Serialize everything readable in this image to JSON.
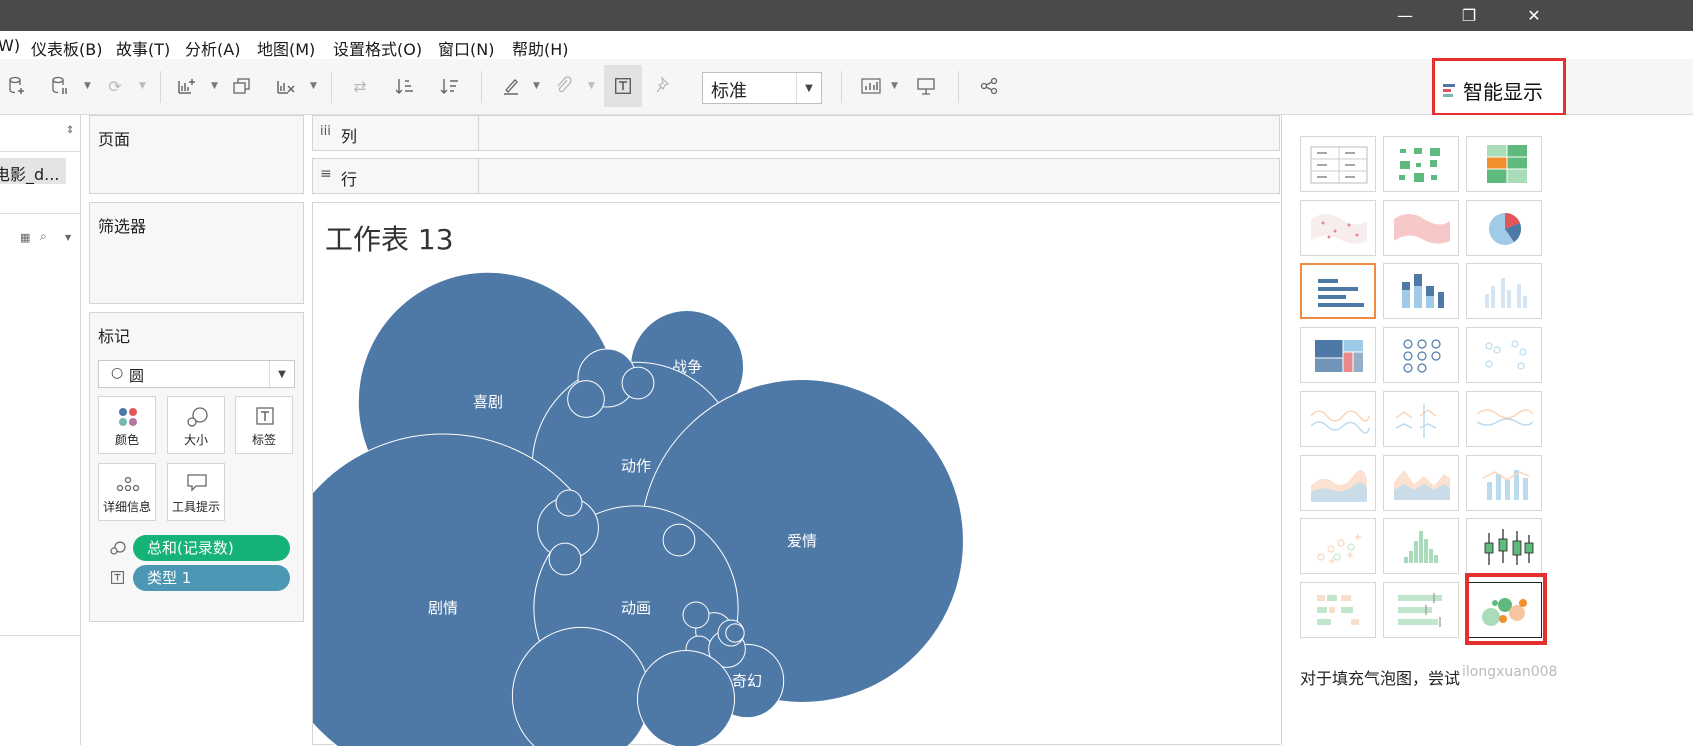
{
  "window": {
    "minimize_glyph": "—",
    "restore_glyph": "❐",
    "close_glyph": "✕"
  },
  "menu": [
    "W)",
    "仪表板(B)",
    "故事(T)",
    "分析(A)",
    "地图(M)",
    "设置格式(O)",
    "窗口(N)",
    "帮助(H)"
  ],
  "toolbar": {
    "mark_size_value": "标准",
    "show_me_label": "智能显示"
  },
  "datasource": {
    "name": "电影_d..."
  },
  "shelves": {
    "pages": "页面",
    "filters": "筛选器",
    "columns": "列",
    "rows": "行"
  },
  "marks": {
    "title": "标记",
    "type": "圆",
    "buttons": [
      {
        "label": "颜色",
        "icon": "color-icon"
      },
      {
        "label": "大小",
        "icon": "size-icon"
      },
      {
        "label": "标签",
        "icon": "label-icon"
      },
      {
        "label": "详细信息",
        "icon": "detail-icon"
      },
      {
        "label": "工具提示",
        "icon": "tooltip-icon"
      }
    ],
    "pills": [
      {
        "text": "总和(记录数)",
        "color": "#16b378",
        "icon": "size-icon"
      },
      {
        "text": "类型   1",
        "color": "#4b97b4",
        "icon": "label-icon"
      }
    ]
  },
  "sheet": {
    "title": "工作表 13"
  },
  "bubble_color": "#4e79a7",
  "bubbles": [
    {
      "label": "喜剧",
      "value": 100
    },
    {
      "label": "战争",
      "value": 19
    },
    {
      "label": "动作",
      "value": 64
    },
    {
      "label": "爱情",
      "value": 155
    },
    {
      "label": "剧情",
      "value": 180
    },
    {
      "label": "动画",
      "value": 62
    },
    {
      "label": "奇幻",
      "value": 8
    },
    {
      "label": "",
      "value": 5
    },
    {
      "label": "",
      "value": 2
    },
    {
      "label": "",
      "value": 1.5
    },
    {
      "label": "",
      "value": 5.5
    },
    {
      "label": "",
      "value": 1.5
    },
    {
      "label": "",
      "value": 1.5
    },
    {
      "label": "",
      "value": 1
    },
    {
      "label": "",
      "value": 2
    },
    {
      "label": "",
      "value": 1
    },
    {
      "label": "",
      "value": 2
    },
    {
      "label": "",
      "value": 1
    },
    {
      "label": "",
      "value": 1
    },
    {
      "label": "",
      "value": 0.5
    },
    {
      "label": "",
      "value": 0.5
    },
    {
      "label": "",
      "value": 28
    },
    {
      "label": "",
      "value": 14
    }
  ],
  "showme": {
    "hint": "对于填充气泡图，尝试",
    "watermark": "ilongxuan008",
    "selected_index": 6,
    "highlighted_index": 23,
    "thumbnails": [
      "text-table-icon",
      "heat-map-icon",
      "highlight-table-icon",
      "symbol-map-icon",
      "filled-map-icon",
      "pie-chart-icon",
      "horizontal-bars-icon",
      "stacked-bars-icon",
      "side-by-side-bars-icon",
      "treemap-icon",
      "circle-views-icon",
      "side-by-side-circles-icon",
      "continuous-lines-icon",
      "discrete-lines-icon",
      "dual-lines-icon",
      "area-continuous-icon",
      "area-discrete-icon",
      "dual-combination-icon",
      "scatter-plot-icon",
      "histogram-icon",
      "box-whisker-icon",
      "gantt-chart-icon",
      "bullet-graph-icon",
      "packed-bubbles-icon"
    ]
  }
}
